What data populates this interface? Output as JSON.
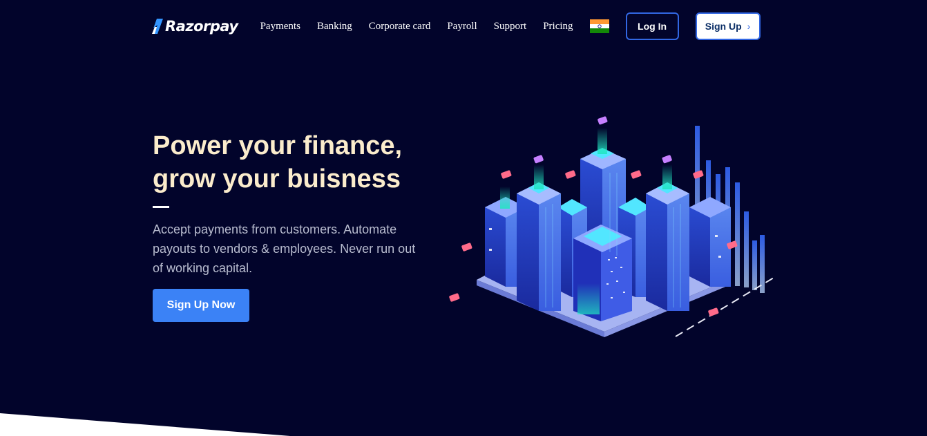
{
  "brand": {
    "name": "Razorpay"
  },
  "nav": {
    "links": [
      "Payments",
      "Banking",
      "Corporate card",
      "Payroll",
      "Support",
      "Pricing"
    ],
    "country_flag_icon": "india-flag-icon",
    "login_label": "Log In",
    "signup_label": "Sign Up",
    "signup_icon": "chevron-right-icon"
  },
  "hero": {
    "title_line1": "Power your finance,",
    "title_line2": "grow your buisness",
    "description": "Accept payments from customers. Automate payouts to vendors & employees. Never run out of working capital.",
    "cta_label": "Sign Up Now",
    "illustration_icon": "isometric-city-illustration"
  },
  "colors": {
    "background": "#02042b",
    "title": "#fbeccc",
    "description": "#b8bccf",
    "accent": "#3267e3",
    "cta": "#3b82f6"
  }
}
